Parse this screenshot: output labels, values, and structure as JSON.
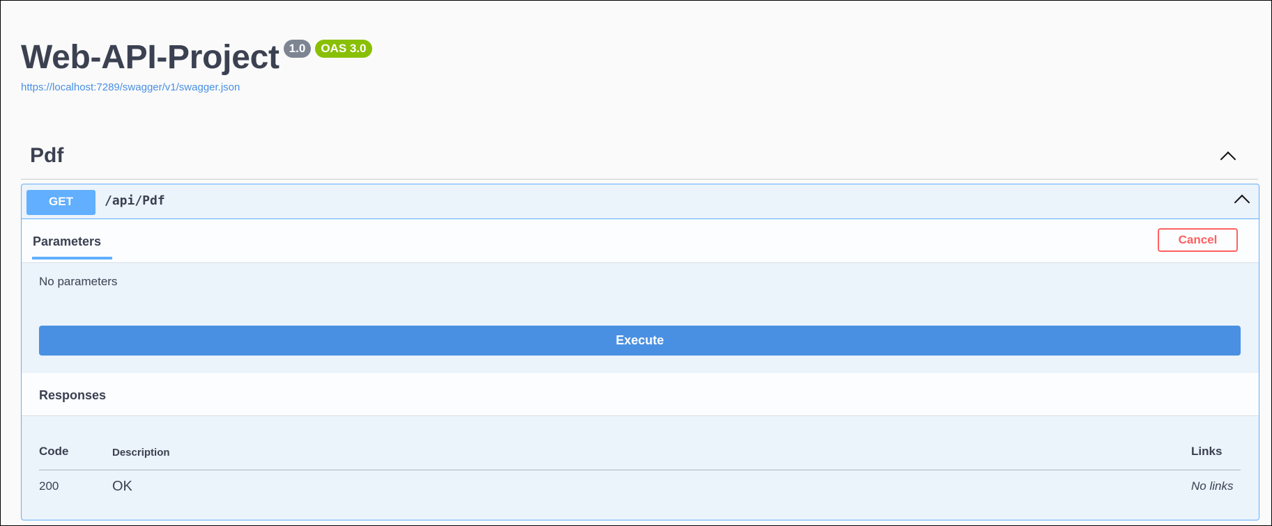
{
  "info": {
    "title": "Web-API-Project",
    "version": "1.0",
    "oas_badge": "OAS 3.0",
    "spec_url": "https://localhost:7289/swagger/v1/swagger.json"
  },
  "tag": {
    "name": "Pdf",
    "chevron_icon": "chevron-up"
  },
  "operation": {
    "method": "GET",
    "path": "/api/Pdf",
    "method_color": "#61affe",
    "tabs": [
      {
        "label": "Parameters",
        "selected": true
      }
    ],
    "cancel_label": "Cancel",
    "no_params_text": "No parameters",
    "execute_label": "Execute",
    "responses": {
      "title": "Responses",
      "columns": [
        "Code",
        "Description",
        "Links"
      ],
      "rows": [
        {
          "code": "200",
          "description": "OK",
          "links": "No links"
        }
      ]
    }
  },
  "colors": {
    "accent": "#61affe",
    "execute": "#4990e2",
    "cancel": "#ff6060",
    "version_badge": "#7d8492",
    "oas_badge": "#89bf04"
  }
}
